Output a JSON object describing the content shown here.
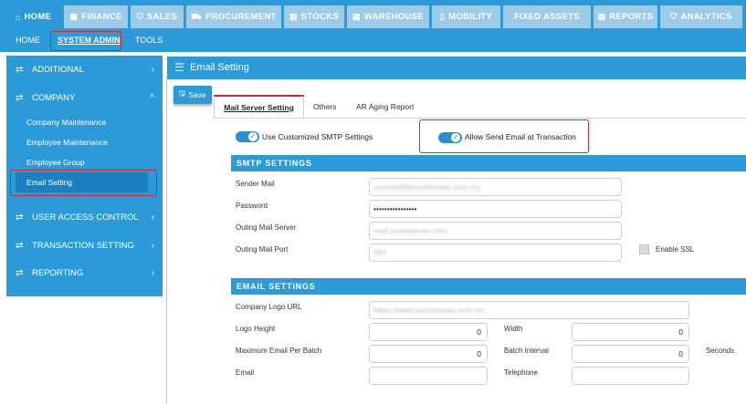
{
  "top_tabs": [
    {
      "label": "HOME",
      "icon": "home-icon",
      "glyph": "⌂"
    },
    {
      "label": "FINANCE",
      "icon": "finance-icon",
      "glyph": "▦"
    },
    {
      "label": "SALES",
      "icon": "cart-icon",
      "glyph": "🛒"
    },
    {
      "label": "PROCUREMENT",
      "icon": "truck-icon",
      "glyph": "⛟"
    },
    {
      "label": "STOCKS",
      "icon": "chart-icon",
      "glyph": "▥"
    },
    {
      "label": "WAREHOUSE",
      "icon": "warehouse-icon",
      "glyph": "▤"
    },
    {
      "label": "MOBILITY",
      "icon": "mobile-icon",
      "glyph": "▯"
    },
    {
      "label": "FIXED ASSETS",
      "icon": "",
      "glyph": ""
    },
    {
      "label": "REPORTS",
      "icon": "reports-icon",
      "glyph": "▥"
    },
    {
      "label": "ANALYTICS",
      "icon": "cart-icon",
      "glyph": "🛒"
    }
  ],
  "sub_tabs": [
    "HOME",
    "SYSTEM ADMIN",
    "TOOLS"
  ],
  "sidebar": {
    "items": [
      {
        "label": "ADDITIONAL",
        "chevron": "›"
      },
      {
        "label": "COMPANY",
        "chevron": "^"
      },
      {
        "label": "USER ACCESS CONTROL",
        "chevron": "›"
      },
      {
        "label": "TRANSACTION SETTING",
        "chevron": "›"
      },
      {
        "label": "REPORTING",
        "chevron": "›"
      }
    ],
    "company_subitems": [
      "Company Maintenance",
      "Employee Maintenance",
      "Employee Group",
      "Email Setting"
    ]
  },
  "content": {
    "title": "Email Setting",
    "save_label": "Save",
    "tabs": [
      "Mail Server Setting",
      "Others",
      "AR Aging Report"
    ],
    "toggles": {
      "smtp_label": "Use Customized SMTP Settings",
      "send_email_label": "Allow Send Email at Transaction"
    },
    "smtp": {
      "header": "SMTP SETTINGS",
      "sender_mail_label": "Sender Mail",
      "sender_mail_value": "yourmail@yourdomain.com.my",
      "password_label": "Password",
      "password_value": "••••••••••••••••",
      "outing_server_label": "Outing Mail Server",
      "outing_server_value": "mail.yourdomain.com",
      "outing_port_label": "Outing Mail Port",
      "outing_port_value": "587",
      "ssl_label": "Enable SSL"
    },
    "email": {
      "header": "EMAIL SETTINGS",
      "logo_url_label": "Company Logo URL",
      "logo_url_value": "https://www.yourdomain.com.my",
      "logo_height_label": "Logo Height",
      "logo_height_value": "0",
      "width_label": "Width",
      "width_value": "0",
      "max_email_label": "Maximum Email Per Batch",
      "max_email_value": "0",
      "batch_interval_label": "Batch Interval",
      "batch_interval_value": "0",
      "seconds_label": "Seconds",
      "email_label": "Email",
      "telephone_label": "Telephone"
    }
  },
  "colors": {
    "primary": "#2a9bd8",
    "tab_inactive": "#9ccbe9",
    "highlight": "#d9232d"
  }
}
